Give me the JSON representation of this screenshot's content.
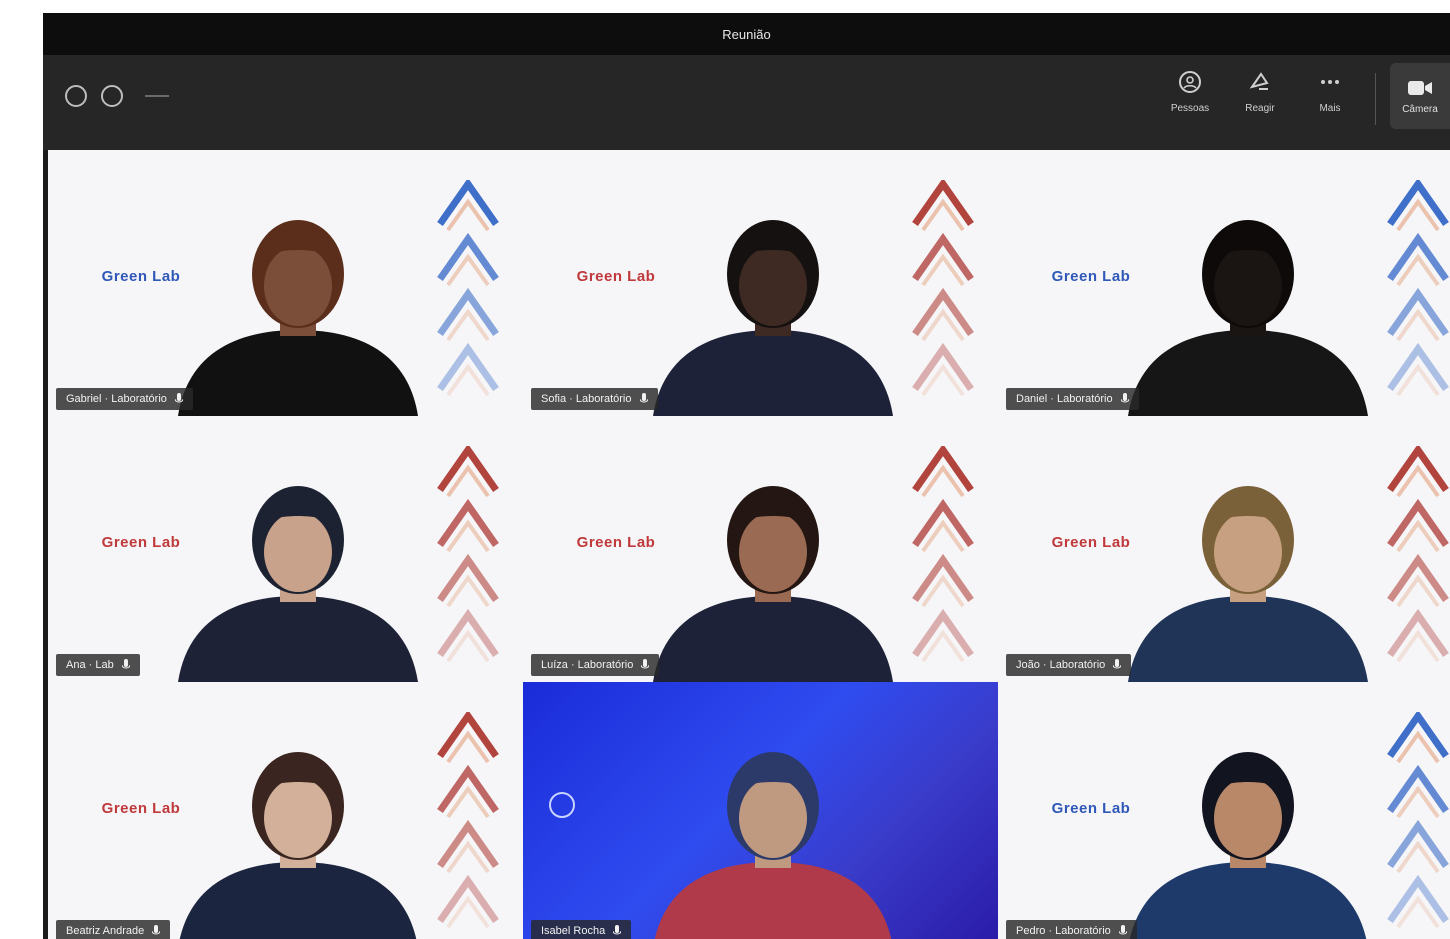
{
  "window": {
    "title": "Reunião"
  },
  "toolbar": {
    "buttons": [
      {
        "label": "Pessoas",
        "icon": "people-icon"
      },
      {
        "label": "Reagir",
        "icon": "react-icon"
      },
      {
        "label": "Mais",
        "icon": "more-icon"
      }
    ],
    "camera_label": "Câmera"
  },
  "participants": [
    {
      "name": "Gabriel · Laboratório",
      "brand": "Green Lab",
      "brand_color": "#2f58b8",
      "chevron_color": "#3f6fc8",
      "skin": "#7a4e38",
      "hair": "#5a2e1a",
      "shirt": "#111111"
    },
    {
      "name": "Sofia · Laboratório",
      "brand": "Green Lab",
      "brand_color": "#c0393b",
      "chevron_color": "#b2443e",
      "skin": "#3e2a22",
      "hair": "#161111",
      "shirt": "#1d2238"
    },
    {
      "name": "Daniel · Laboratório",
      "brand": "Green Lab",
      "brand_color": "#2f58b8",
      "chevron_color": "#3f6fc8",
      "skin": "#1a1412",
      "hair": "#0d0a09",
      "shirt": "#161616"
    },
    {
      "name": "Ana · Lab",
      "brand": "Green Lab",
      "brand_color": "#c0393b",
      "chevron_color": "#b2443e",
      "skin": "#c8a28a",
      "hair": "#1d2233",
      "shirt": "#1e2236"
    },
    {
      "name": "Luíza · Laboratório",
      "brand": "Green Lab",
      "brand_color": "#c0393b",
      "chevron_color": "#b2443e",
      "skin": "#9a6a52",
      "hair": "#241612",
      "shirt": "#1d2238"
    },
    {
      "name": "João · Laboratório",
      "brand": "Green Lab",
      "brand_color": "#c0393b",
      "chevron_color": "#b2443e",
      "skin": "#c6a080",
      "hair": "#7b6139",
      "shirt": "#203458"
    },
    {
      "name": "Beatriz Andrade",
      "brand": "Green Lab",
      "brand_color": "#c0393b",
      "chevron_color": "#b2443e",
      "skin": "#d2b09a",
      "hair": "#3a2520",
      "shirt": "#1c2540"
    },
    {
      "name": "Isabel Rocha",
      "brand": "",
      "brand_color": "#ffffff",
      "chevron_color": "#ffffff",
      "skin": "#c09a80",
      "hair": "#2c3a6a",
      "shirt": "#b03a4a"
    },
    {
      "name": "Pedro · Laboratório",
      "brand": "Green Lab",
      "brand_color": "#2f58b8",
      "chevron_color": "#3f6fc8",
      "skin": "#b88868",
      "hair": "#121420",
      "shirt": "#1e3a6a"
    }
  ]
}
